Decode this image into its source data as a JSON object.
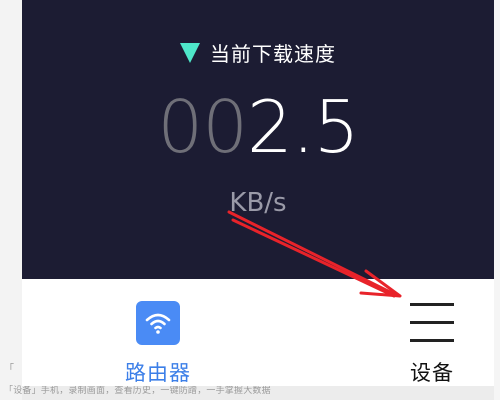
{
  "header": {
    "title": "当前下载速度",
    "icon": "triangle-down-icon",
    "icon_color": "#4ee6c9"
  },
  "speed": {
    "leading_zeros": "00",
    "value": "2.5",
    "unit": "KB/s"
  },
  "tabbar": {
    "router": {
      "label": "路由器",
      "icon": "wifi-icon",
      "color": "#4a8bf5"
    },
    "device": {
      "label": "设备",
      "icon": "menu-icon"
    }
  },
  "background": {
    "line1": "「",
    "line2": "「设备」手机，录制画面，查看历史，一键防蹭，一手掌握大数据"
  },
  "colors": {
    "panel": "#1c1c33",
    "annotation_arrow": "#e8232a"
  }
}
